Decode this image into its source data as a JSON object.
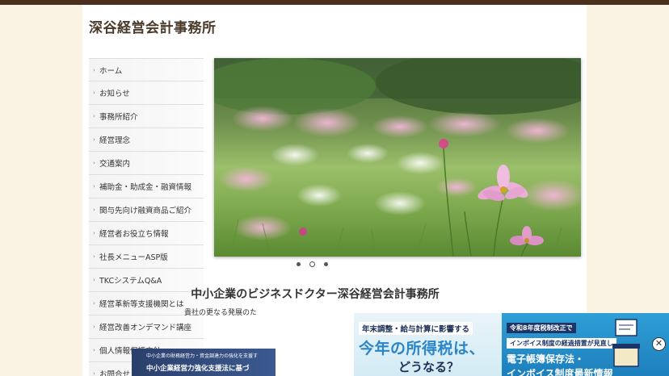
{
  "site": {
    "title": "深谷経営会計事務所"
  },
  "sidebar": {
    "items": [
      {
        "label": "ホーム"
      },
      {
        "label": "お知らせ"
      },
      {
        "label": "事務所紹介"
      },
      {
        "label": "経営理念"
      },
      {
        "label": "交通案内"
      },
      {
        "label": "補助金・助成金・融資情報"
      },
      {
        "label": "関与先向け融資商品ご紹介"
      },
      {
        "label": "経営者お役立ち情報"
      },
      {
        "label": "社長メニューASP版"
      },
      {
        "label": "TKCシステムQ&A"
      },
      {
        "label": "経営革新等支援機関とは"
      },
      {
        "label": "経営改善オンデマンド講座"
      },
      {
        "label": "個人情報保護方針"
      },
      {
        "label": "お問合せ"
      }
    ]
  },
  "slider": {
    "slide_count": 3,
    "active_index": 1
  },
  "main": {
    "heading": "中小企業のビジネスドクター深谷経営会計事務所",
    "subtext": "貴社の更なる発展のた"
  },
  "lower_banner": {
    "line1": "中小企業の財務経営力・資金調達力の強化を支援す",
    "line2": "中小企業経営力強化支援法に基づ"
  },
  "ad": {
    "left_tag": "年末調整・給与計算に影響する",
    "left_big1": "今年の所得税は、",
    "left_big2": "どうなる？",
    "right_line1": "令和8年度税制改正で",
    "right_line2": "インボイス制度の経過措置が見直し",
    "right_line3": "電子帳簿保存法・",
    "right_line4": "インボイス制度最新情報",
    "close_symbol": "✕"
  },
  "colors": {
    "top_strip": "#4a2f1c",
    "page_background": "#faf3e3",
    "ad_blue": "#2f9fd6",
    "ad_navy": "#1c2f55"
  }
}
